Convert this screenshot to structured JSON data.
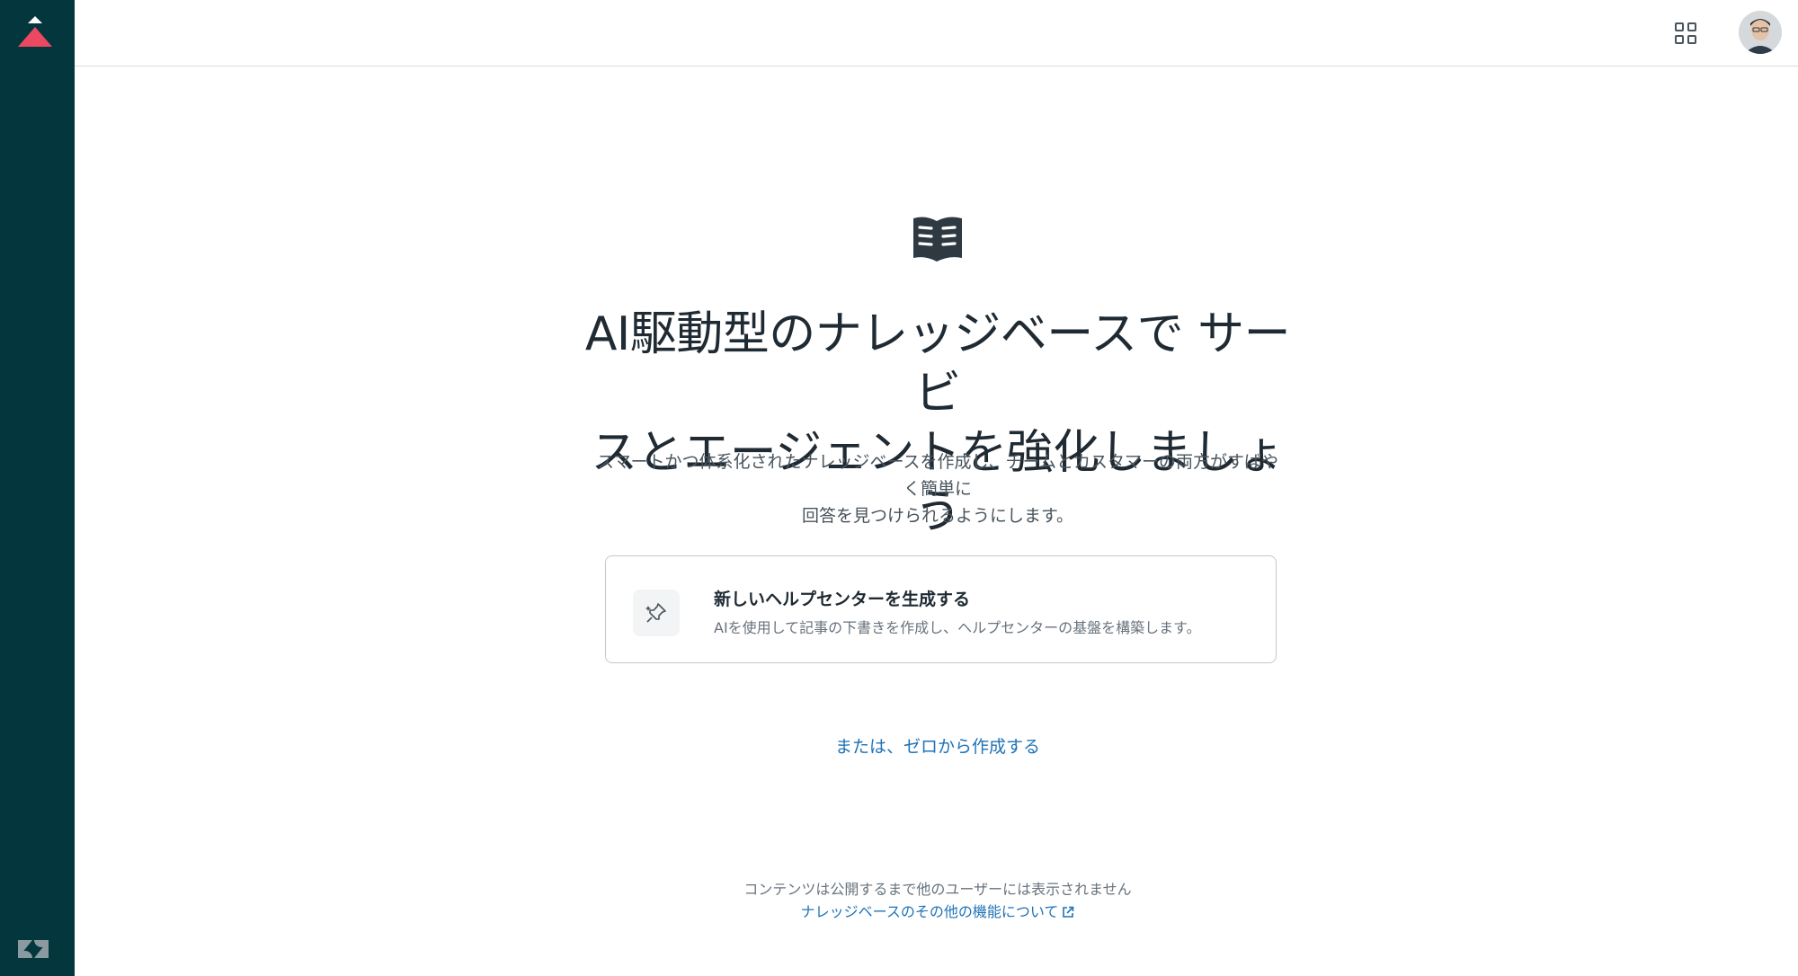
{
  "header": {
    "apps_icon": "grid-icon",
    "avatar_icon": "user-avatar"
  },
  "main": {
    "icon": "book-open-icon",
    "headline_line1": "AI駆動型のナレッジベースで サービ",
    "headline_line2": "スとエージェントを強化しましょう",
    "subtext_line1": "スマートかつ体系化されたナレッジベースを作成し、チームとカスタマーの両方がすばやく簡単に",
    "subtext_line2": "回答を見つけられるようにします。",
    "card": {
      "icon": "sparkle-pin-icon",
      "title": "新しいヘルプセンターを生成する",
      "description": "AIを使用して記事の下書きを作成し、ヘルプセンターの基盤を構築します。"
    },
    "scratch_link": "または、ゼロから作成する",
    "footer_note": "コンテンツは公開するまで他のユーザーには表示されません",
    "footer_link": "ナレッジベースのその他の機能について"
  },
  "colors": {
    "sidebar": "#03363d",
    "accent_red": "#eb4962",
    "link": "#1f73b7"
  }
}
